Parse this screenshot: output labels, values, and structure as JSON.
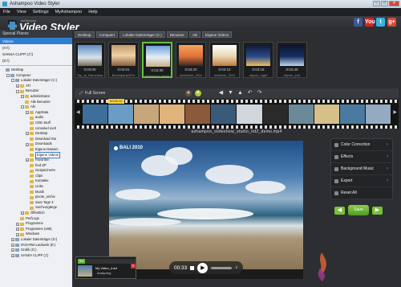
{
  "window": {
    "title": "Ashampoo Video Styler"
  },
  "menu": [
    "File",
    "View",
    "Settings",
    "MyAshampoo",
    "Help"
  ],
  "header": {
    "brand_small": "Ashampoo",
    "brand": "Video Styler"
  },
  "social": [
    {
      "icon": "facebook-icon",
      "glyph": "f",
      "color": "#3b5998"
    },
    {
      "icon": "youtube-icon",
      "glyph": "You",
      "color": "#d8261f"
    },
    {
      "icon": "twitter-icon",
      "glyph": "t",
      "color": "#32b4e6"
    },
    {
      "icon": "google-icon",
      "glyph": "g+",
      "color": "#d24a3a"
    }
  ],
  "sidebar": {
    "special_places": "Special Places",
    "places": [
      {
        "label": "Videos",
        "selected": true
      },
      {
        "label": "(H:\\)",
        "selected": false
      },
      {
        "label": "SANSA CLIPP (J:\\)",
        "selected": false
      },
      {
        "label": "(D:\\)",
        "selected": false
      }
    ],
    "tree": [
      {
        "label": "Desktop",
        "indent": 0,
        "type": "b",
        "pm": ""
      },
      {
        "label": "Computer",
        "indent": 1,
        "type": "b",
        "pm": "-"
      },
      {
        "label": "Lokaler Datenträger (C:)",
        "indent": 2,
        "type": "b",
        "pm": "-"
      },
      {
        "label": "ATI",
        "indent": 3,
        "type": "f",
        "pm": "+"
      },
      {
        "label": "Benutzer",
        "indent": 3,
        "type": "f",
        "pm": "-"
      },
      {
        "label": "administrator",
        "indent": 4,
        "type": "f",
        "pm": "+"
      },
      {
        "label": "Alle Benutzer",
        "indent": 4,
        "type": "f",
        "pm": ""
      },
      {
        "label": "Aki",
        "indent": 4,
        "type": "f",
        "pm": "-"
      },
      {
        "label": "AppData",
        "indent": 5,
        "type": "f",
        "pm": "+"
      },
      {
        "label": "audio",
        "indent": 5,
        "type": "f",
        "pm": ""
      },
      {
        "label": "CRD Stuff",
        "indent": 5,
        "type": "f",
        "pm": ""
      },
      {
        "label": "consoled melt",
        "indent": 5,
        "type": "f",
        "pm": ""
      },
      {
        "label": "Desktop",
        "indent": 5,
        "type": "f",
        "pm": "+"
      },
      {
        "label": "Download Sto",
        "indent": 5,
        "type": "f",
        "pm": ""
      },
      {
        "label": "Downloads",
        "indent": 5,
        "type": "f",
        "pm": "+"
      },
      {
        "label": "Eigene Dateien",
        "indent": 5,
        "type": "f",
        "pm": ""
      },
      {
        "label": "Eigene Videos",
        "indent": 5,
        "type": "f",
        "pm": "",
        "highlight": true
      },
      {
        "label": "Favoriten",
        "indent": 5,
        "type": "f",
        "pm": "+"
      },
      {
        "label": "fred ZP",
        "indent": 5,
        "type": "f",
        "pm": ""
      },
      {
        "label": "Gespeicherte",
        "indent": 5,
        "type": "f",
        "pm": ""
      },
      {
        "label": "Clips",
        "indent": 5,
        "type": "f",
        "pm": ""
      },
      {
        "label": "Kontakte",
        "indent": 5,
        "type": "f",
        "pm": ""
      },
      {
        "label": "Links",
        "indent": 5,
        "type": "f",
        "pm": ""
      },
      {
        "label": "Musik",
        "indent": 5,
        "type": "f",
        "pm": ""
      },
      {
        "label": "pixote_archiv",
        "indent": 5,
        "type": "f",
        "pm": ""
      },
      {
        "label": "save Tage 3",
        "indent": 5,
        "type": "f",
        "pm": ""
      },
      {
        "label": "Suchvorgänge",
        "indent": 5,
        "type": "f",
        "pm": ""
      },
      {
        "label": "Öffentlich",
        "indent": 4,
        "type": "f",
        "pm": "+"
      },
      {
        "label": "PerfLogs",
        "indent": 3,
        "type": "f",
        "pm": ""
      },
      {
        "label": "Programme",
        "indent": 3,
        "type": "f",
        "pm": "+"
      },
      {
        "label": "Programme (x86)",
        "indent": 3,
        "type": "f",
        "pm": "+"
      },
      {
        "label": "Windows",
        "indent": 3,
        "type": "f",
        "pm": "+"
      },
      {
        "label": "Lokaler Datenträger (D:)",
        "indent": 2,
        "type": "b",
        "pm": "+"
      },
      {
        "label": "DVD-RW-Laufwerk (E:)",
        "indent": 2,
        "type": "b",
        "pm": "+"
      },
      {
        "label": "Grafik (G:)",
        "indent": 2,
        "type": "b",
        "pm": "+"
      },
      {
        "label": "SANSA CLIPP (J:)",
        "indent": 2,
        "type": "b",
        "pm": "+"
      }
    ]
  },
  "breadcrumb": [
    "Desktop",
    "Computer",
    "Lokaler Datenträger (C:)",
    "Benutzer",
    "Aki",
    "Eigene Videos"
  ],
  "media": [
    {
      "duration": "0:03:00",
      "name": "Trip_to_Barcelona",
      "bg": "linear-gradient(#5b8bc4,#d8e3ea 60%,#7a6a55)"
    },
    {
      "duration": "0:03:01",
      "name": "Beachparty2011",
      "bg": "linear-gradient(#c49a6a,#f0d0a8 50%,#8a5e3a)"
    },
    {
      "duration": "0:04:39",
      "name": "ashampoo_slides",
      "bg": "linear-gradient(#6aa0d8,#e8eef2 55%,#c4b089)",
      "selected": true
    },
    {
      "duration": "0:03:20",
      "name": "surfmovie_2011",
      "bg": "linear-gradient(#f2a45a,#e0703a 55%,#3a2a20)"
    },
    {
      "duration": "0:03:10",
      "name": "footstore_2011",
      "bg": "linear-gradient(#ffffff,#e8d4b0 55%,#c47a3a)"
    },
    {
      "duration": "0:03:18",
      "name": "cityrun_night",
      "bg": "linear-gradient(#0c1a3a,#2a4a8a 55%,#f0c060)"
    },
    {
      "duration": "0:03:40",
      "name": "cityrun_end",
      "bg": "linear-gradient(#0a1430,#183060 55%,#c0d8f0)"
    }
  ],
  "toolbar": {
    "fullscreen": "Full Screen"
  },
  "filmstrip": {
    "time": "00:00:12",
    "frames": [
      "#3e6f9a",
      "#6a9cc5",
      "#c7a77a",
      "#e0b37a",
      "#8a5a3a",
      "#3a5a7a",
      "#cfd6dc",
      "#2a2a2a",
      "#6a8a9a",
      "#d6c08a",
      "#4a7aa0",
      "#94aac0"
    ]
  },
  "clip_name": "ashampoo_slideshow_studio_hd2_demo.mp4",
  "preview": {
    "caption": "BALI 2010",
    "time": "00:33"
  },
  "panel": [
    {
      "label": "Color Correction",
      "icon": "color-correction-icon"
    },
    {
      "label": "Effects",
      "icon": "effects-icon"
    },
    {
      "label": "Background Music",
      "icon": "music-icon"
    },
    {
      "label": "Export",
      "icon": "export-icon"
    },
    {
      "label": "Reset All",
      "icon": "reset-icon"
    }
  ],
  "save_label": "Save",
  "queue": {
    "progress": "5%",
    "progress_value": 5,
    "name": "My Video_4.avi",
    "status": "Analyzing"
  }
}
